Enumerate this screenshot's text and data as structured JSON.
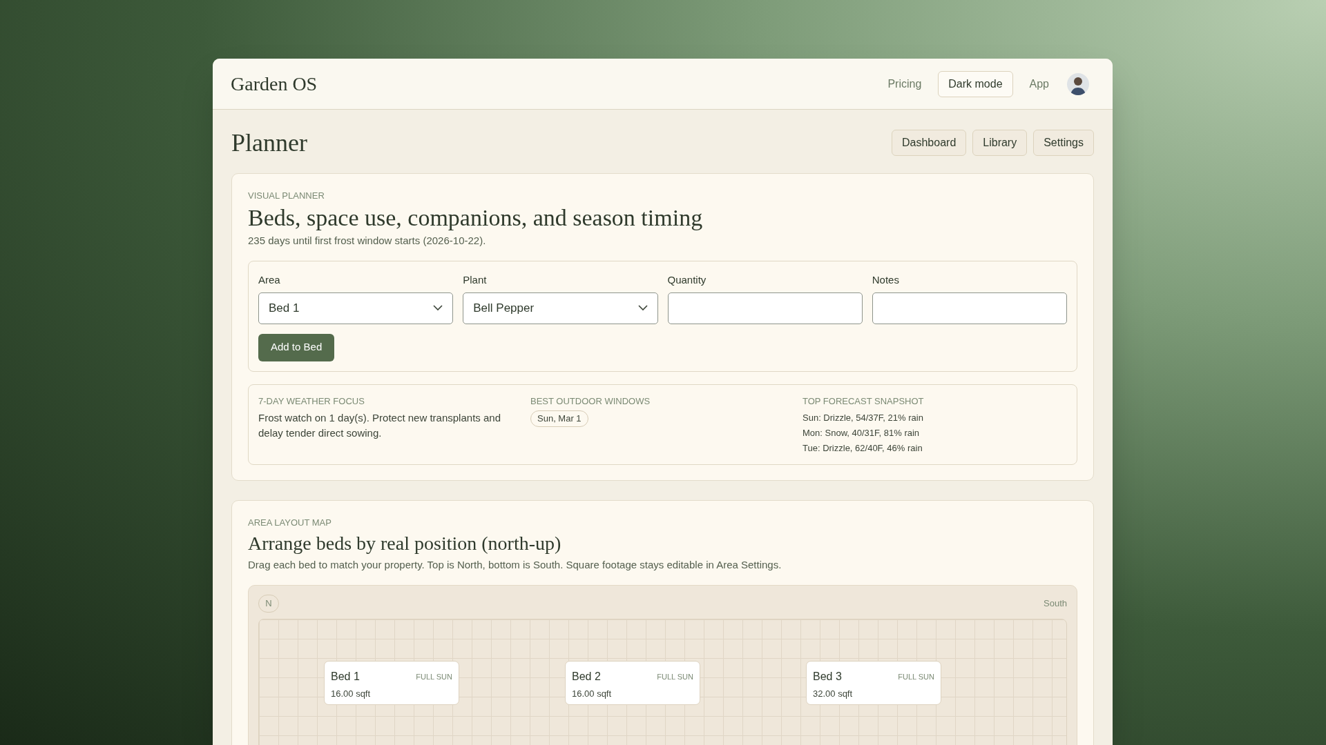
{
  "header": {
    "brand": "Garden OS",
    "nav": [
      {
        "label": "Pricing",
        "kind": "link"
      },
      {
        "label": "Dark mode",
        "kind": "button"
      },
      {
        "label": "App",
        "kind": "link"
      }
    ]
  },
  "page": {
    "title": "Planner",
    "buttons": [
      "Dashboard",
      "Library",
      "Settings"
    ]
  },
  "visual_planner": {
    "eyebrow": "VISUAL PLANNER",
    "heading": "Beds, space use, companions, and season timing",
    "subtitle": "235 days until first frost window starts (2026-10-22).",
    "form": {
      "fields": [
        {
          "label": "Area",
          "kind": "select",
          "value": "Bed 1"
        },
        {
          "label": "Plant",
          "kind": "select",
          "value": "Bell Pepper"
        },
        {
          "label": "Quantity",
          "kind": "text"
        },
        {
          "label": "Notes",
          "kind": "text"
        }
      ],
      "submit": "Add to Bed"
    },
    "weather": [
      {
        "heading": "7-DAY WEATHER FOCUS",
        "kind": "text",
        "text": "Frost watch on 1 day(s). Protect new transplants and delay tender direct sowing."
      },
      {
        "heading": "BEST OUTDOOR WINDOWS",
        "kind": "chips",
        "items": [
          "Sun, Mar 1"
        ]
      },
      {
        "heading": "TOP FORECAST SNAPSHOT",
        "kind": "lines",
        "items": [
          "Sun: Drizzle, 54/37F, 21% rain",
          "Mon: Snow, 40/31F, 81% rain",
          "Tue: Drizzle, 62/40F, 46% rain"
        ]
      }
    ]
  },
  "area_layout": {
    "eyebrow": "AREA LAYOUT MAP",
    "heading": "Arrange beds by real position (north-up)",
    "description": "Drag each bed to match your property. Top is North, bottom is South. Square footage stays editable in Area Settings.",
    "compass": "N",
    "edge_label": "South",
    "beds": [
      {
        "name": "Bed 1",
        "sun": "FULL SUN",
        "size": "16.00 sqft"
      },
      {
        "name": "Bed 2",
        "sun": "FULL SUN",
        "size": "16.00 sqft"
      },
      {
        "name": "Bed 3",
        "sun": "FULL SUN",
        "size": "32.00 sqft"
      }
    ]
  }
}
